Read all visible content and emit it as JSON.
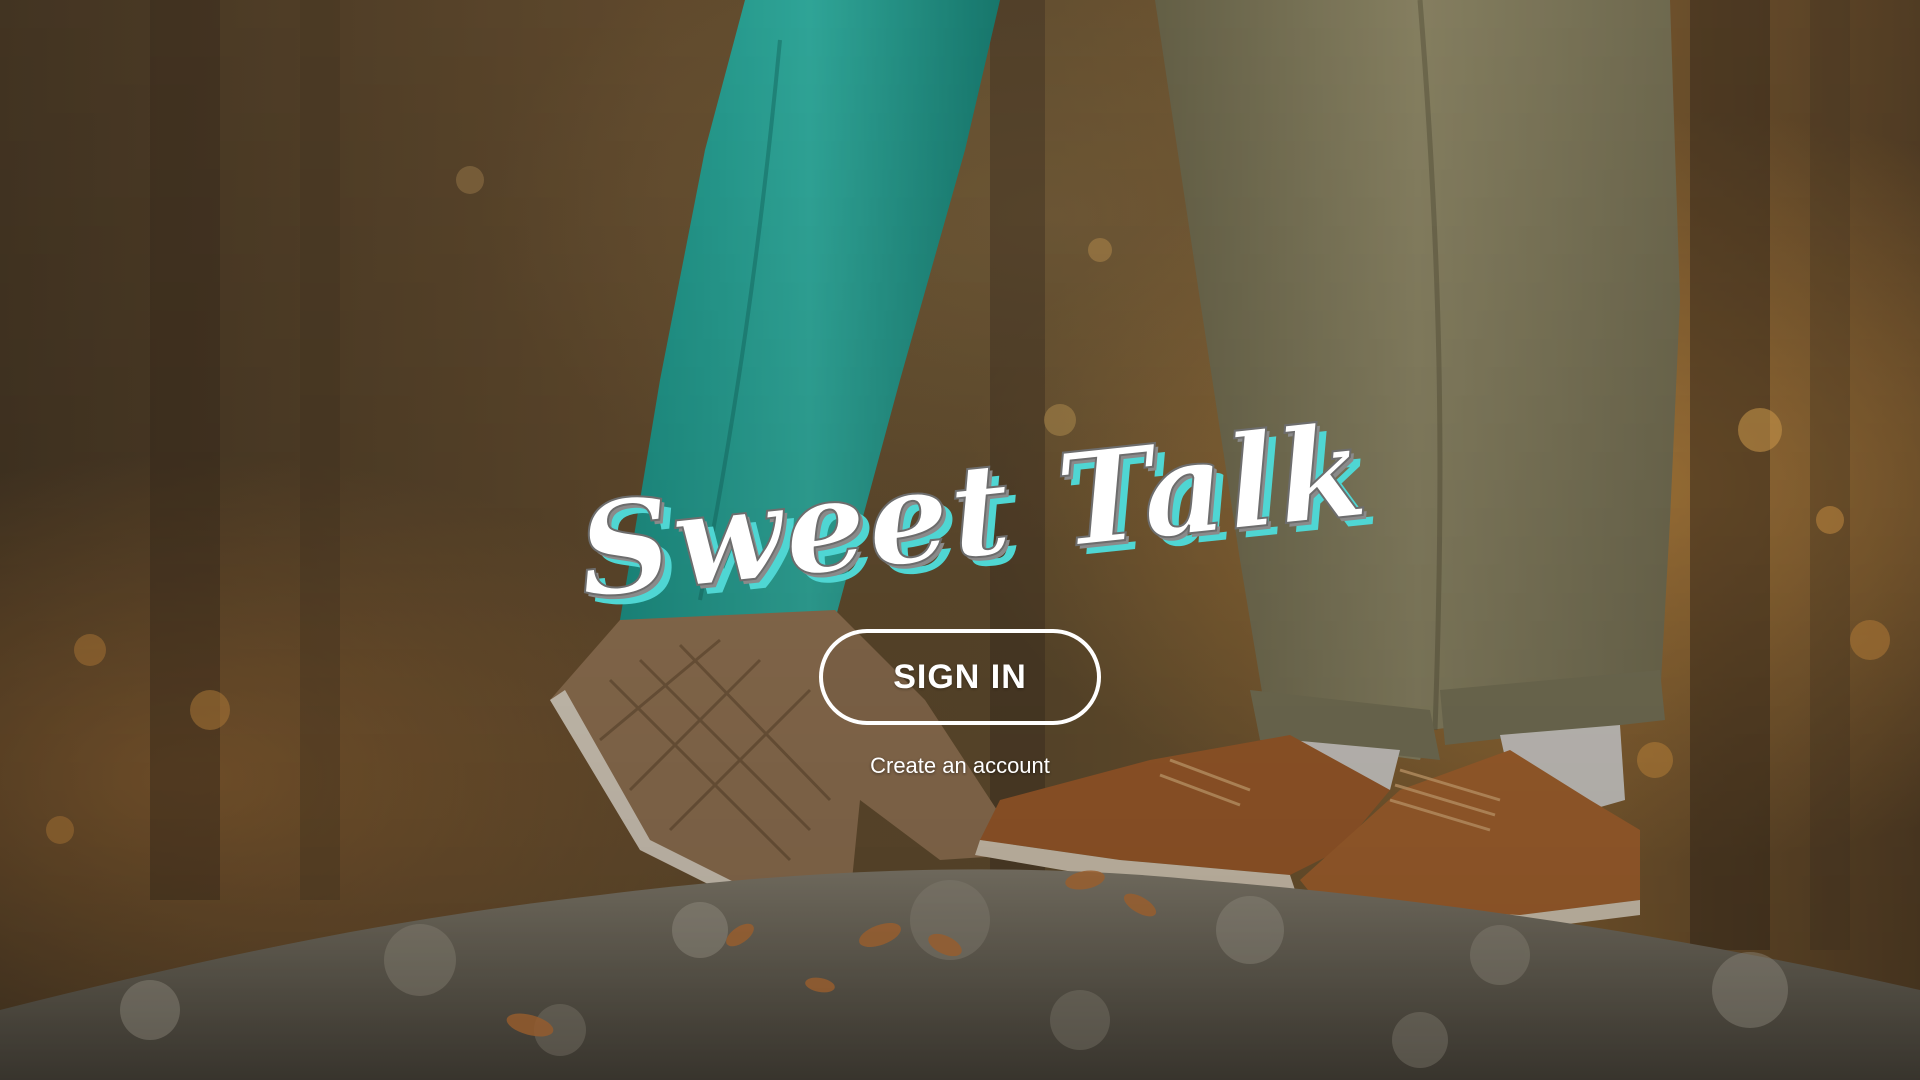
{
  "app": {
    "logo_text": "Sweet Talk",
    "background_image": "autumn-forest-couple-feet-photo"
  },
  "actions": {
    "sign_in_label": "SIGN IN",
    "create_account_label": "Create an account"
  },
  "colors": {
    "logo_fill": "#ffffff",
    "logo_shadow": "#4fd6d3",
    "logo_outline": "#7a7a7a",
    "button_border": "#ffffff",
    "link_text": "#ffffff"
  }
}
